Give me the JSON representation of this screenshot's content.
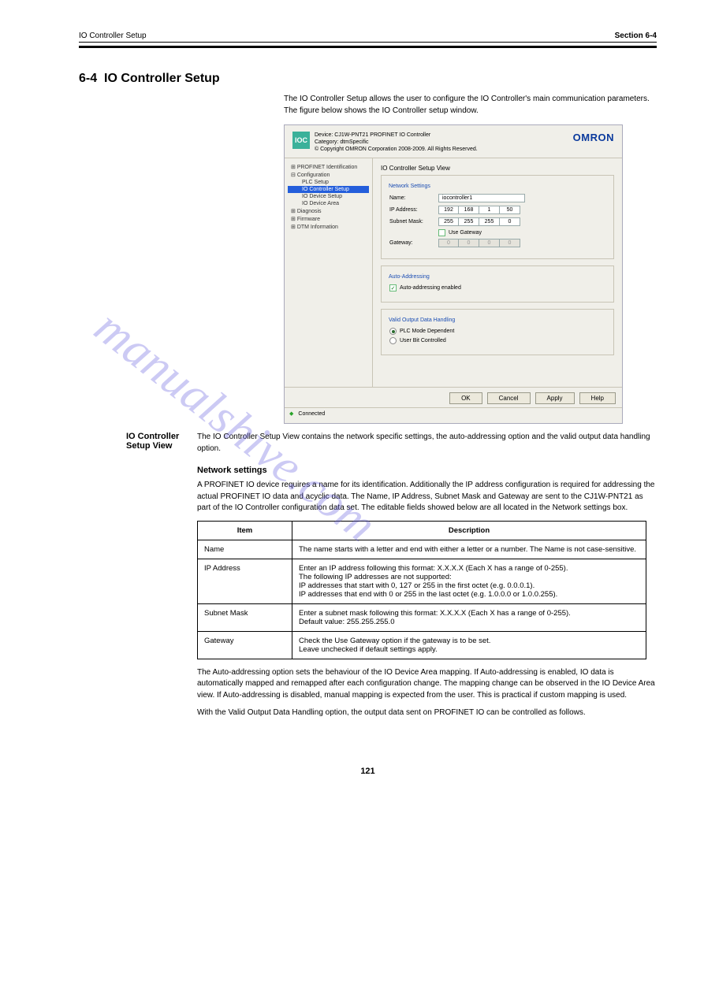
{
  "header": {
    "left": "IO Controller Setup",
    "right_section": "Section 6-4"
  },
  "section": {
    "number": "6-4",
    "title": "IO Controller Setup",
    "intro": "The IO Controller Setup allows the user to configure the IO Controller's main communication parameters. The figure below shows the IO Controller setup window.",
    "body1": "The IO Controller Setup View contains the network specific settings, the auto-addressing option and the valid output data handling option.",
    "body2": "A PROFINET IO device requires a name for its identification. Additionally the IP address configuration is required for addressing the actual PROFINET IO data and acyclic data. The Name, IP Address, Subnet Mask and Gateway are sent to the CJ1W-PNT21 as part of the IO Controller configuration data set. The editable fields showed below are all located in the Network settings box.",
    "subhead": "Network settings",
    "table": {
      "headers": [
        "Item",
        "Description"
      ],
      "rows": [
        [
          "Name",
          "The name starts with a letter and end with either a letter or a number. The Name is not case-sensitive."
        ],
        [
          "IP Address",
          "Enter an IP address following this format: X.X.X.X (Each X has a range of 0-255).\nThe following IP addresses are not supported:\nIP addresses that start with 0, 127 or 255 in the first octet (e.g. 0.0.0.1).\nIP addresses that end with 0 or 255 in the last octet (e.g. 1.0.0.0 or 1.0.0.255)."
        ],
        [
          "Subnet Mask",
          "Enter a subnet mask following this format: X.X.X.X (Each X has a range of 0-255).\nDefault value: 255.255.255.0"
        ],
        [
          "Gateway",
          "Check the Use Gateway option if the gateway is to be set.\nLeave unchecked if default settings apply."
        ]
      ]
    },
    "body3": "The Auto-addressing option sets the behaviour of the IO Device Area mapping. If Auto-addressing is enabled, IO data is automatically mapped and remapped after each configuration change. The mapping change can be observed in the IO Device Area view. If Auto-addressing is disabled, manual mapping is expected from the user. This is practical if custom mapping is used.",
    "body4": "With the Valid Output Data Handling option, the output data sent on PROFINET IO can be controlled as follows."
  },
  "sidebar_label": "IO Controller Setup View",
  "app": {
    "ioc": "IOC",
    "device_label": "Device:",
    "device": "CJ1W-PNT21 PROFINET IO Controller",
    "category_label": "Category:",
    "category": "dtmSpecific",
    "copyright": "© Copyright OMRON Corporation 2008-2009. All Rights Reserved.",
    "brand": "OMRON",
    "tree": {
      "t0": "PROFINET Identification",
      "t1": "Configuration",
      "t1a": "PLC Setup",
      "t1b": "IO Controller Setup",
      "t1c": "IO Device Setup",
      "t1d": "IO Device Area",
      "t2": "Diagnosis",
      "t3": "Firmware",
      "t4": "DTM Information"
    },
    "pane_title": "IO Controller Setup View",
    "grp_network": "Network Settings",
    "name_label": "Name:",
    "name_value": "iocontroller1",
    "ip_label": "IP Address:",
    "ip": [
      "192",
      "168",
      "1",
      "50"
    ],
    "mask_label": "Subnet Mask:",
    "mask": [
      "255",
      "255",
      "255",
      "0"
    ],
    "use_gateway": "Use Gateway",
    "gateway_label": "Gateway:",
    "gw": [
      "0",
      "0",
      "0",
      "0"
    ],
    "grp_auto": "Auto-Addressing",
    "auto_enabled": "Auto-addressing enabled",
    "grp_valid": "Valid Output Data Handling",
    "radio_plc": "PLC Mode Dependent",
    "radio_user": "User Bit Controlled",
    "btn_ok": "OK",
    "btn_cancel": "Cancel",
    "btn_apply": "Apply",
    "btn_help": "Help",
    "status": "Connected"
  },
  "watermark": "manualshive.com",
  "page": "121"
}
